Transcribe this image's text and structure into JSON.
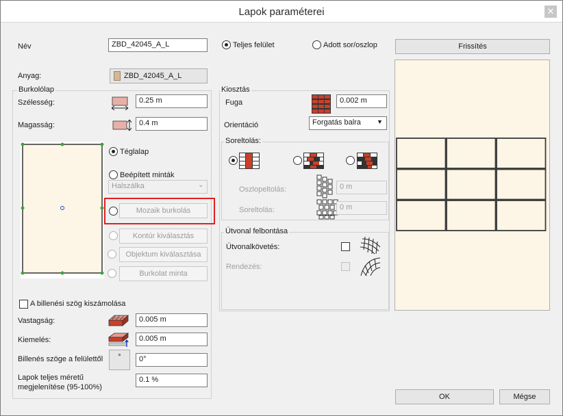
{
  "window": {
    "title": "Lapok paraméterei",
    "close_glyph": "✕"
  },
  "name": {
    "label": "Név",
    "value": "ZBD_42045_A_L"
  },
  "surface_mode": {
    "full_label": "Teljes felület",
    "full_selected": true,
    "rowcol_label": "Adott sor/oszlop"
  },
  "refresh_button": "Frissítés",
  "material": {
    "label": "Anyag:",
    "value": "ZBD_42045_A_L"
  },
  "tile": {
    "group_title": "Burkolólap",
    "width_label": "Szélesség:",
    "width_value": "0.25 m",
    "height_label": "Magasság:",
    "height_value": "0.4 m",
    "shape_rect_label": "Téglalap",
    "builtin_label": "Beépített minták",
    "builtin_select_value": "Halszálka",
    "mosaic_button": "Mozaik burkolás",
    "contour_button": "Kontúr kiválasztás",
    "object_button": "Objektum kiválasztása",
    "pattern_button": "Burkolat minta"
  },
  "layout": {
    "group_title": "Kiosztás",
    "joint_label": "Fuga",
    "joint_value": "0.002 m",
    "orientation_label": "Orientáció",
    "orientation_value": "Forgatás balra",
    "offset_group_title": "Soreltolás:",
    "column_offset_label": "Oszlopeltolás:",
    "column_offset_value": "0 m",
    "row_offset_label": "Soreltolás:",
    "row_offset_value": "0 m"
  },
  "path": {
    "group_title": "Útvonal felbontása",
    "follow_label": "Útvonalkövetés:",
    "arrange_label": "Rendezés:"
  },
  "tilt_checkbox_label": "A billenési szög kiszámolása",
  "thickness": {
    "label": "Vastagság:",
    "value": "0.005 m"
  },
  "raise": {
    "label": "Kiemelés:",
    "value": "0.005 m"
  },
  "tilt_angle": {
    "label": "Billenés szöge a felülettől",
    "value": "0°",
    "button_glyph": "°"
  },
  "full_size": {
    "label_line1": "Lapok teljes méretű",
    "label_line2": "megjelenítése (95-100%)",
    "value": "0.1 %"
  },
  "ok_button": "OK",
  "cancel_button": "Mégse",
  "colors": {
    "highlight_red": "#e02020",
    "preview_bg": "#fdf5e6",
    "tile_line": "#3a3a3a",
    "brick_red": "#c8402a"
  },
  "icons": {
    "width_icon": "tile-width-icon",
    "height_icon": "tile-height-icon",
    "joint_icon": "brick-grid-icon",
    "thickness_icon": "tile-thickness-icon",
    "raise_icon": "tile-raise-icon",
    "follow_icon": "grid-follow-icon",
    "arrange_icon": "arc-arrange-icon"
  }
}
